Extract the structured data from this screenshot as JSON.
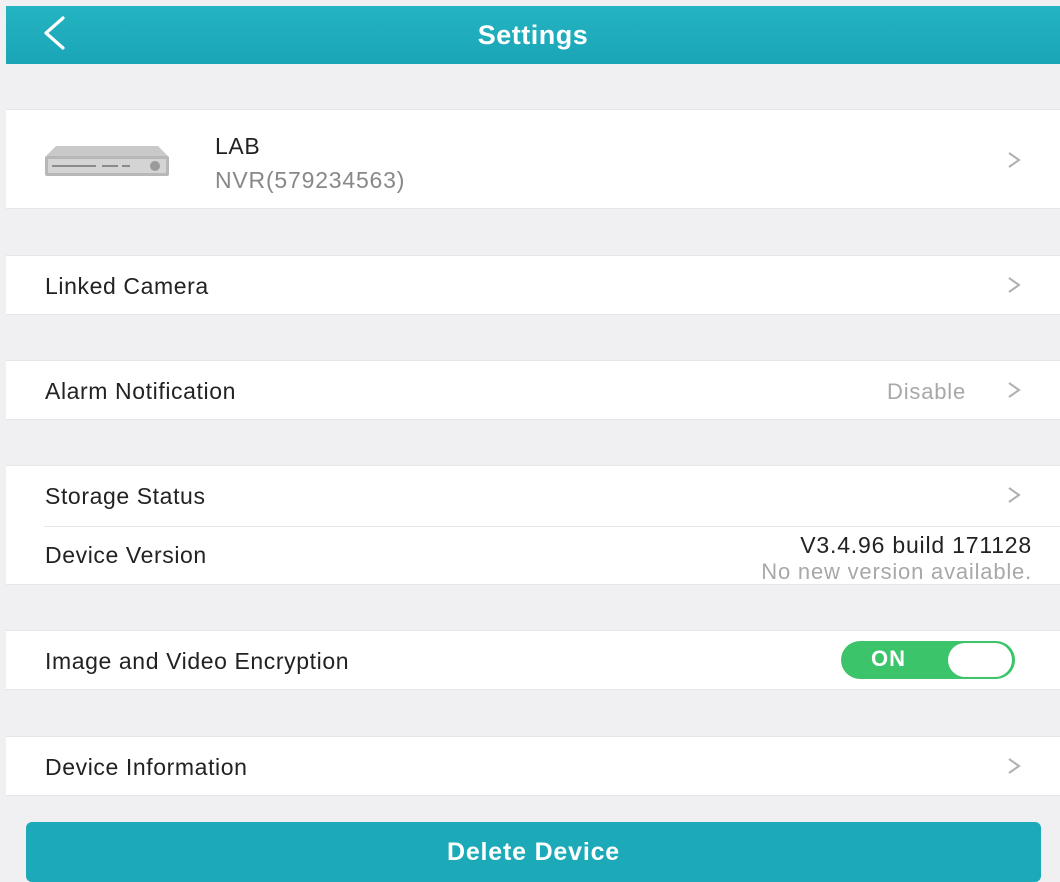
{
  "header": {
    "title": "Settings",
    "back_icon": "chevron-left-icon"
  },
  "device": {
    "name": "LAB",
    "model": "NVR(579234563)",
    "icon": "nvr-device-icon"
  },
  "rows": {
    "linked_camera": {
      "label": "Linked Camera"
    },
    "alarm_notification": {
      "label": "Alarm Notification",
      "value": "Disable"
    },
    "storage_status": {
      "label": "Storage Status"
    },
    "device_version": {
      "label": "Device Version",
      "version": "V3.4.96 build 171128",
      "status": "No new version available."
    },
    "encryption": {
      "label": "Image and Video Encryption",
      "toggle_label": "ON",
      "enabled": true
    },
    "device_information": {
      "label": "Device Information"
    }
  },
  "actions": {
    "delete_label": "Delete Device"
  },
  "colors": {
    "header": "#1ea9b8",
    "toggle_on": "#3cc46a",
    "delete_button": "#1ca9b8",
    "secondary_text": "#a8a8a8"
  }
}
